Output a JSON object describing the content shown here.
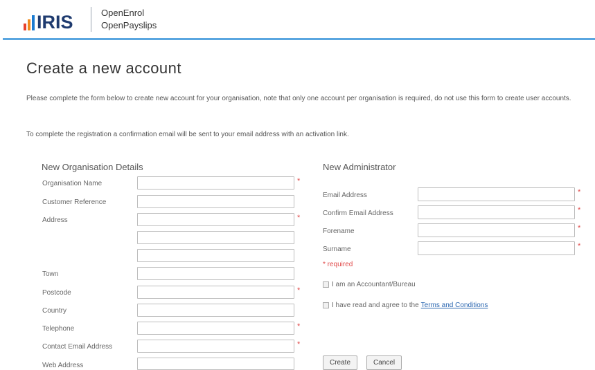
{
  "header": {
    "logo_text": "IRIS",
    "product_lines": [
      "OpenEnrol",
      "OpenPayslips"
    ]
  },
  "page": {
    "title": "Create a new account",
    "intro_1": "Please complete the form below to create new account for your organisation, note that only one account per organisation is required, do not use this form to create user accounts.",
    "intro_2": "To complete the registration a confirmation email will be sent to your email address with an activation link."
  },
  "org_section": {
    "title": "New Organisation Details",
    "labels": {
      "organisation_name": "Organisation Name",
      "customer_reference": "Customer Reference",
      "address": "Address",
      "town": "Town",
      "postcode": "Postcode",
      "country": "Country",
      "telephone": "Telephone",
      "contact_email": "Contact Email Address",
      "web_address": "Web Address"
    },
    "values": {
      "organisation_name": "",
      "customer_reference": "",
      "address_1": "",
      "address_2": "",
      "address_3": "",
      "town": "",
      "postcode": "",
      "country": "",
      "telephone": "",
      "contact_email": "",
      "web_address": ""
    }
  },
  "admin_section": {
    "title": "New Administrator",
    "labels": {
      "email": "Email Address",
      "confirm_email": "Confirm Email Address",
      "forename": "Forename",
      "surname": "Surname"
    },
    "values": {
      "email": "",
      "confirm_email": "",
      "forename": "",
      "surname": ""
    },
    "required_note": "* required",
    "accountant_label": "I am an Accountant/Bureau",
    "terms_prefix": "I have read and agree to the",
    "terms_link": "Terms and Conditions"
  },
  "required_marker": "*",
  "buttons": {
    "create": "Create",
    "cancel": "Cancel"
  },
  "colors": {
    "accent_line": "#5aa6e0",
    "required": "#e04a4a",
    "link": "#2a66b0",
    "logo_text": "#1f3b6f"
  }
}
